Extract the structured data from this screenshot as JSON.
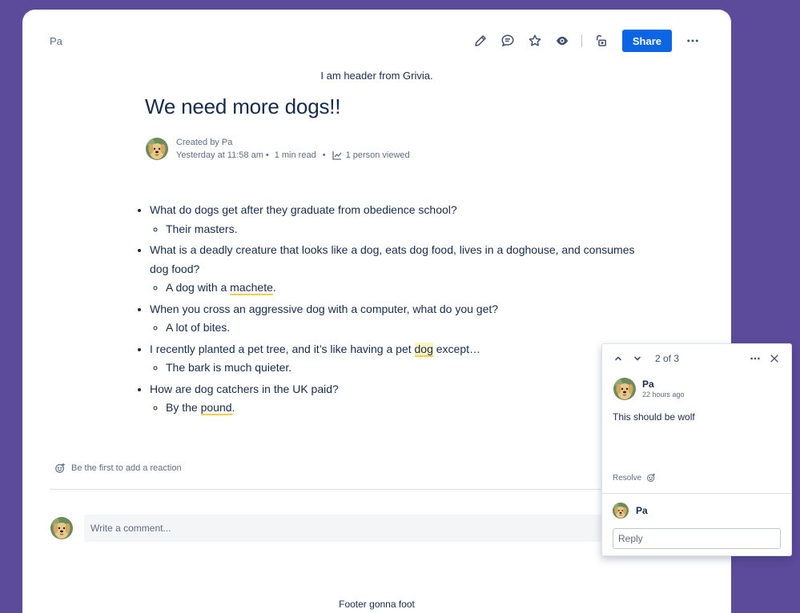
{
  "breadcrumb": {
    "space": "Pa"
  },
  "toolbar": {
    "share_label": "Share"
  },
  "page": {
    "header_text": "I am header from Grivia.",
    "title": "We need more dogs!!",
    "byline": {
      "created_by": "Created by Pa",
      "date": "Yesterday at 11:58 am",
      "read_time": "1 min read",
      "viewed": "1 person viewed"
    },
    "footer_text": "Footer gonna foot"
  },
  "content": {
    "items": [
      {
        "q": "What do dogs get after they graduate from obedience school?",
        "a": "Their masters."
      },
      {
        "q": "What is a deadly creature that looks like a dog, eats dog food, lives in a doghouse, and consumes dog food?",
        "a_pre": "A dog with a ",
        "a_hl": "machete",
        "a_post": "."
      },
      {
        "q": "When you cross an aggressive dog with a computer, what do you get?",
        "a": "A lot of bites."
      },
      {
        "q_pre": "I recently planted a pet tree, and it’s like having a pet ",
        "q_hl": "dog",
        "q_post": " except…",
        "a": "The bark is much quieter."
      },
      {
        "q": "How are dog catchers in the UK paid?",
        "a_pre": "By the ",
        "a_hl": "pound",
        "a_post": "."
      }
    ]
  },
  "reactions": {
    "prompt": "Be the first to add a reaction"
  },
  "comments": {
    "placeholder": "Write a comment..."
  },
  "comment_panel": {
    "count": "2 of 3",
    "author": "Pa",
    "time": "22 hours ago",
    "body": "This should be wolf",
    "resolve_label": "Resolve",
    "reply_author": "Pa",
    "reply_placeholder": "Reply"
  },
  "colors": {
    "background": "#5b4b9a",
    "accent": "#0c66e4",
    "highlight": "#f5cd47"
  },
  "icons": [
    "edit-icon",
    "comment-icon",
    "star-icon",
    "watch-icon",
    "restrictions-icon",
    "more-icon",
    "chart-icon",
    "emoji-icon",
    "chevron-up-icon",
    "chevron-down-icon",
    "close-icon"
  ]
}
